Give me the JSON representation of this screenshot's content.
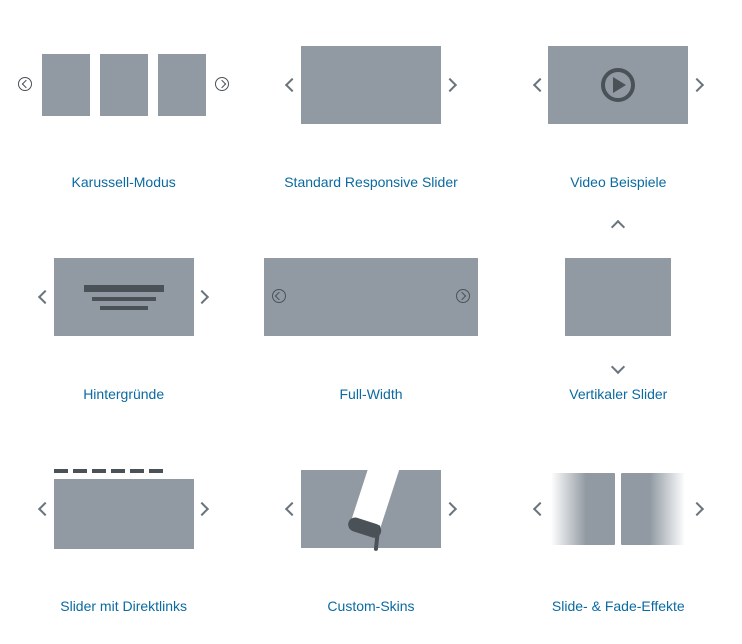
{
  "items": [
    {
      "id": "karussell",
      "label": "Karussell-Modus"
    },
    {
      "id": "standard",
      "label": "Standard Responsive Slider"
    },
    {
      "id": "video",
      "label": "Video Beispiele"
    },
    {
      "id": "hintergruende",
      "label": "Hintergründe"
    },
    {
      "id": "fullwidth",
      "label": "Full-Width"
    },
    {
      "id": "vertikal",
      "label": "Vertikaler Slider"
    },
    {
      "id": "direktlinks",
      "label": "Slider mit Direktlinks"
    },
    {
      "id": "skins",
      "label": "Custom-Skins"
    },
    {
      "id": "fade",
      "label": "Slide- & Fade-Effekte"
    }
  ]
}
